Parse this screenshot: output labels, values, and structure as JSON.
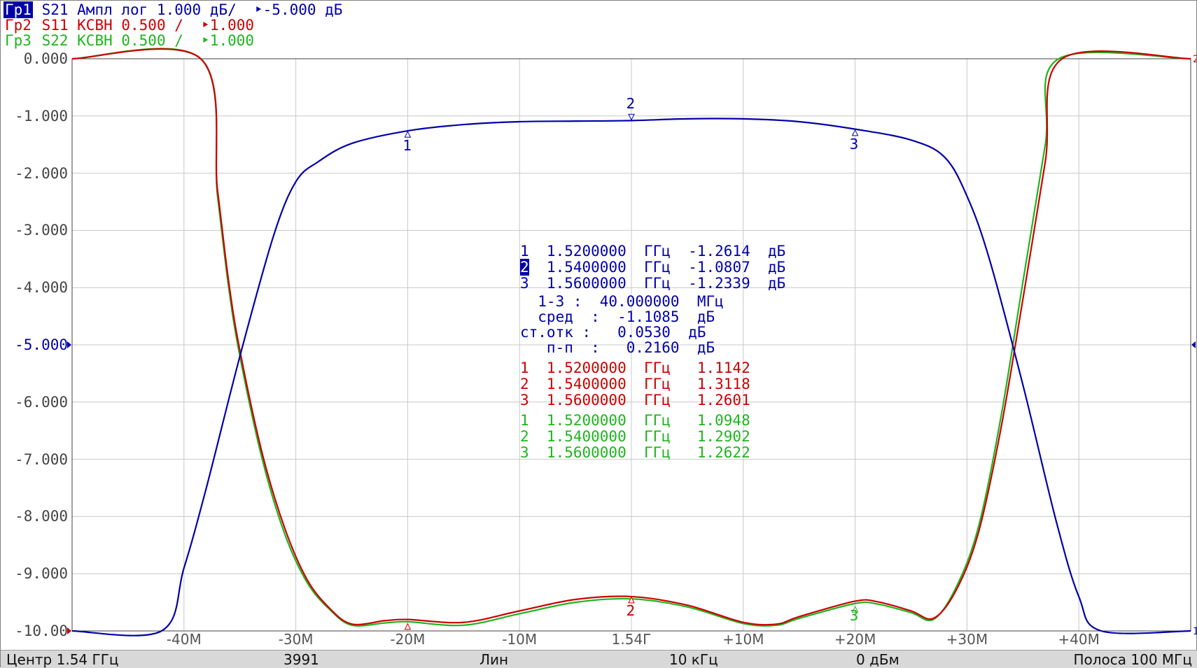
{
  "header": {
    "trace1": {
      "tag": "Гр1",
      "text": " S21 Ампл лог 1.000 дБ/  ‣-5.000 дБ"
    },
    "trace2": {
      "tag": "Гр2",
      "text": " S11 КСВН 0.500 /  ‣1.000"
    },
    "trace3": {
      "tag": "Гр3",
      "text": " S22 КСВН 0.500 /  ‣1.000"
    }
  },
  "y_axis_labels": [
    "0.000",
    "-1.000",
    "-2.000",
    "-3.000",
    "-4.000",
    "-5.000",
    "-6.000",
    "-7.000",
    "-8.000",
    "-9.000",
    "-10.00"
  ],
  "x_axis_labels": [
    "-40M",
    "-30M",
    "-20M",
    "-10M",
    "1.54Г",
    "+10M",
    "+20M",
    "+30M",
    "+40M"
  ],
  "markers_s21": [
    {
      "text": "1  1.5200000  ГГц  -1.2614  дБ"
    },
    {
      "num": "2",
      "text": "  1.5400000  ГГц  -1.0807  дБ"
    },
    {
      "text": "3  1.5600000  ГГц  -1.2339  дБ"
    }
  ],
  "stats": [
    "  1-3 :  40.000000  МГц",
    "  сред  :  -1.1085  дБ",
    "ст.отк :   0.0530  дБ",
    "   п-п  :   0.2160  дБ"
  ],
  "markers_s11": [
    "1  1.5200000  ГГц   1.1142",
    "2  1.5400000  ГГц   1.3118",
    "3  1.5600000  ГГц   1.2601"
  ],
  "markers_s22": [
    "1  1.5200000  ГГц   1.0948",
    "2  1.5400000  ГГц   1.2902",
    "3  1.5600000  ГГц   1.2622"
  ],
  "marker_numbers": [
    "1",
    "2",
    "3"
  ],
  "status_bar": {
    "center": "Центр 1.54 ГГц",
    "points": "3991",
    "sweep": "Лин",
    "ifbw": "10 кГц",
    "power": "0 дБм",
    "span": "Полоса 100 МГц"
  },
  "colors": {
    "s21": "#0000aa",
    "s11": "#cc0000",
    "s22": "#1db51d"
  },
  "chart_data": {
    "type": "line",
    "x_unit": "MHz offset from 1.54 GHz",
    "xlim": [
      -50,
      50
    ],
    "ylim": [
      -10,
      0
    ],
    "grid": true,
    "series": [
      {
        "name": "S21",
        "color": "#0000aa",
        "x": [
          -50,
          -42,
          -40,
          -38,
          -35,
          -32,
          -30,
          -28,
          -25,
          -20,
          -15,
          -10,
          -5,
          0,
          5,
          10,
          15,
          20,
          25,
          28,
          30,
          32,
          35,
          38,
          40,
          42,
          50
        ],
        "y": [
          -10,
          -10,
          -8.9,
          -7.5,
          -5.2,
          -3.1,
          -2.15,
          -1.8,
          -1.48,
          -1.26,
          -1.15,
          -1.1,
          -1.09,
          -1.08,
          -1.05,
          -1.05,
          -1.1,
          -1.23,
          -1.42,
          -1.72,
          -2.4,
          -3.5,
          -5.7,
          -8.1,
          -9.4,
          -10,
          -10
        ]
      },
      {
        "name": "S11",
        "color": "#cc0000",
        "x": [
          -50,
          -38.5,
          -37,
          -36,
          -35,
          -33,
          -31,
          -29,
          -27,
          -25,
          -22,
          -20,
          -15,
          -10,
          -5,
          0,
          5,
          10,
          13,
          15,
          20,
          22,
          25,
          27,
          29,
          31,
          33,
          35,
          37,
          38.5,
          50
        ],
        "y": [
          0,
          0,
          -2.3,
          -3.9,
          -5.1,
          -6.9,
          -8.2,
          -9.1,
          -9.6,
          -9.88,
          -9.82,
          -9.8,
          -9.85,
          -9.65,
          -9.45,
          -9.4,
          -9.55,
          -9.85,
          -9.88,
          -9.75,
          -9.48,
          -9.49,
          -9.65,
          -9.78,
          -9.3,
          -8.3,
          -6.5,
          -4.2,
          -1.8,
          0,
          0
        ]
      },
      {
        "name": "S22",
        "color": "#1db51d",
        "x": [
          -50,
          -38.5,
          -37,
          -36,
          -35,
          -33,
          -31,
          -29,
          -27,
          -25,
          -22,
          -20,
          -15,
          -10,
          -5,
          0,
          5,
          10,
          13,
          15,
          20,
          22,
          25,
          27,
          29,
          31,
          33,
          35,
          37,
          38.2,
          50
        ],
        "y": [
          0,
          0,
          -2.4,
          -4.0,
          -5.2,
          -7.0,
          -8.3,
          -9.15,
          -9.62,
          -9.9,
          -9.86,
          -9.84,
          -9.9,
          -9.7,
          -9.5,
          -9.44,
          -9.58,
          -9.87,
          -9.9,
          -9.78,
          -9.52,
          -9.53,
          -9.68,
          -9.8,
          -9.25,
          -8.2,
          -6.3,
          -3.9,
          -1.5,
          0,
          0
        ]
      }
    ]
  }
}
